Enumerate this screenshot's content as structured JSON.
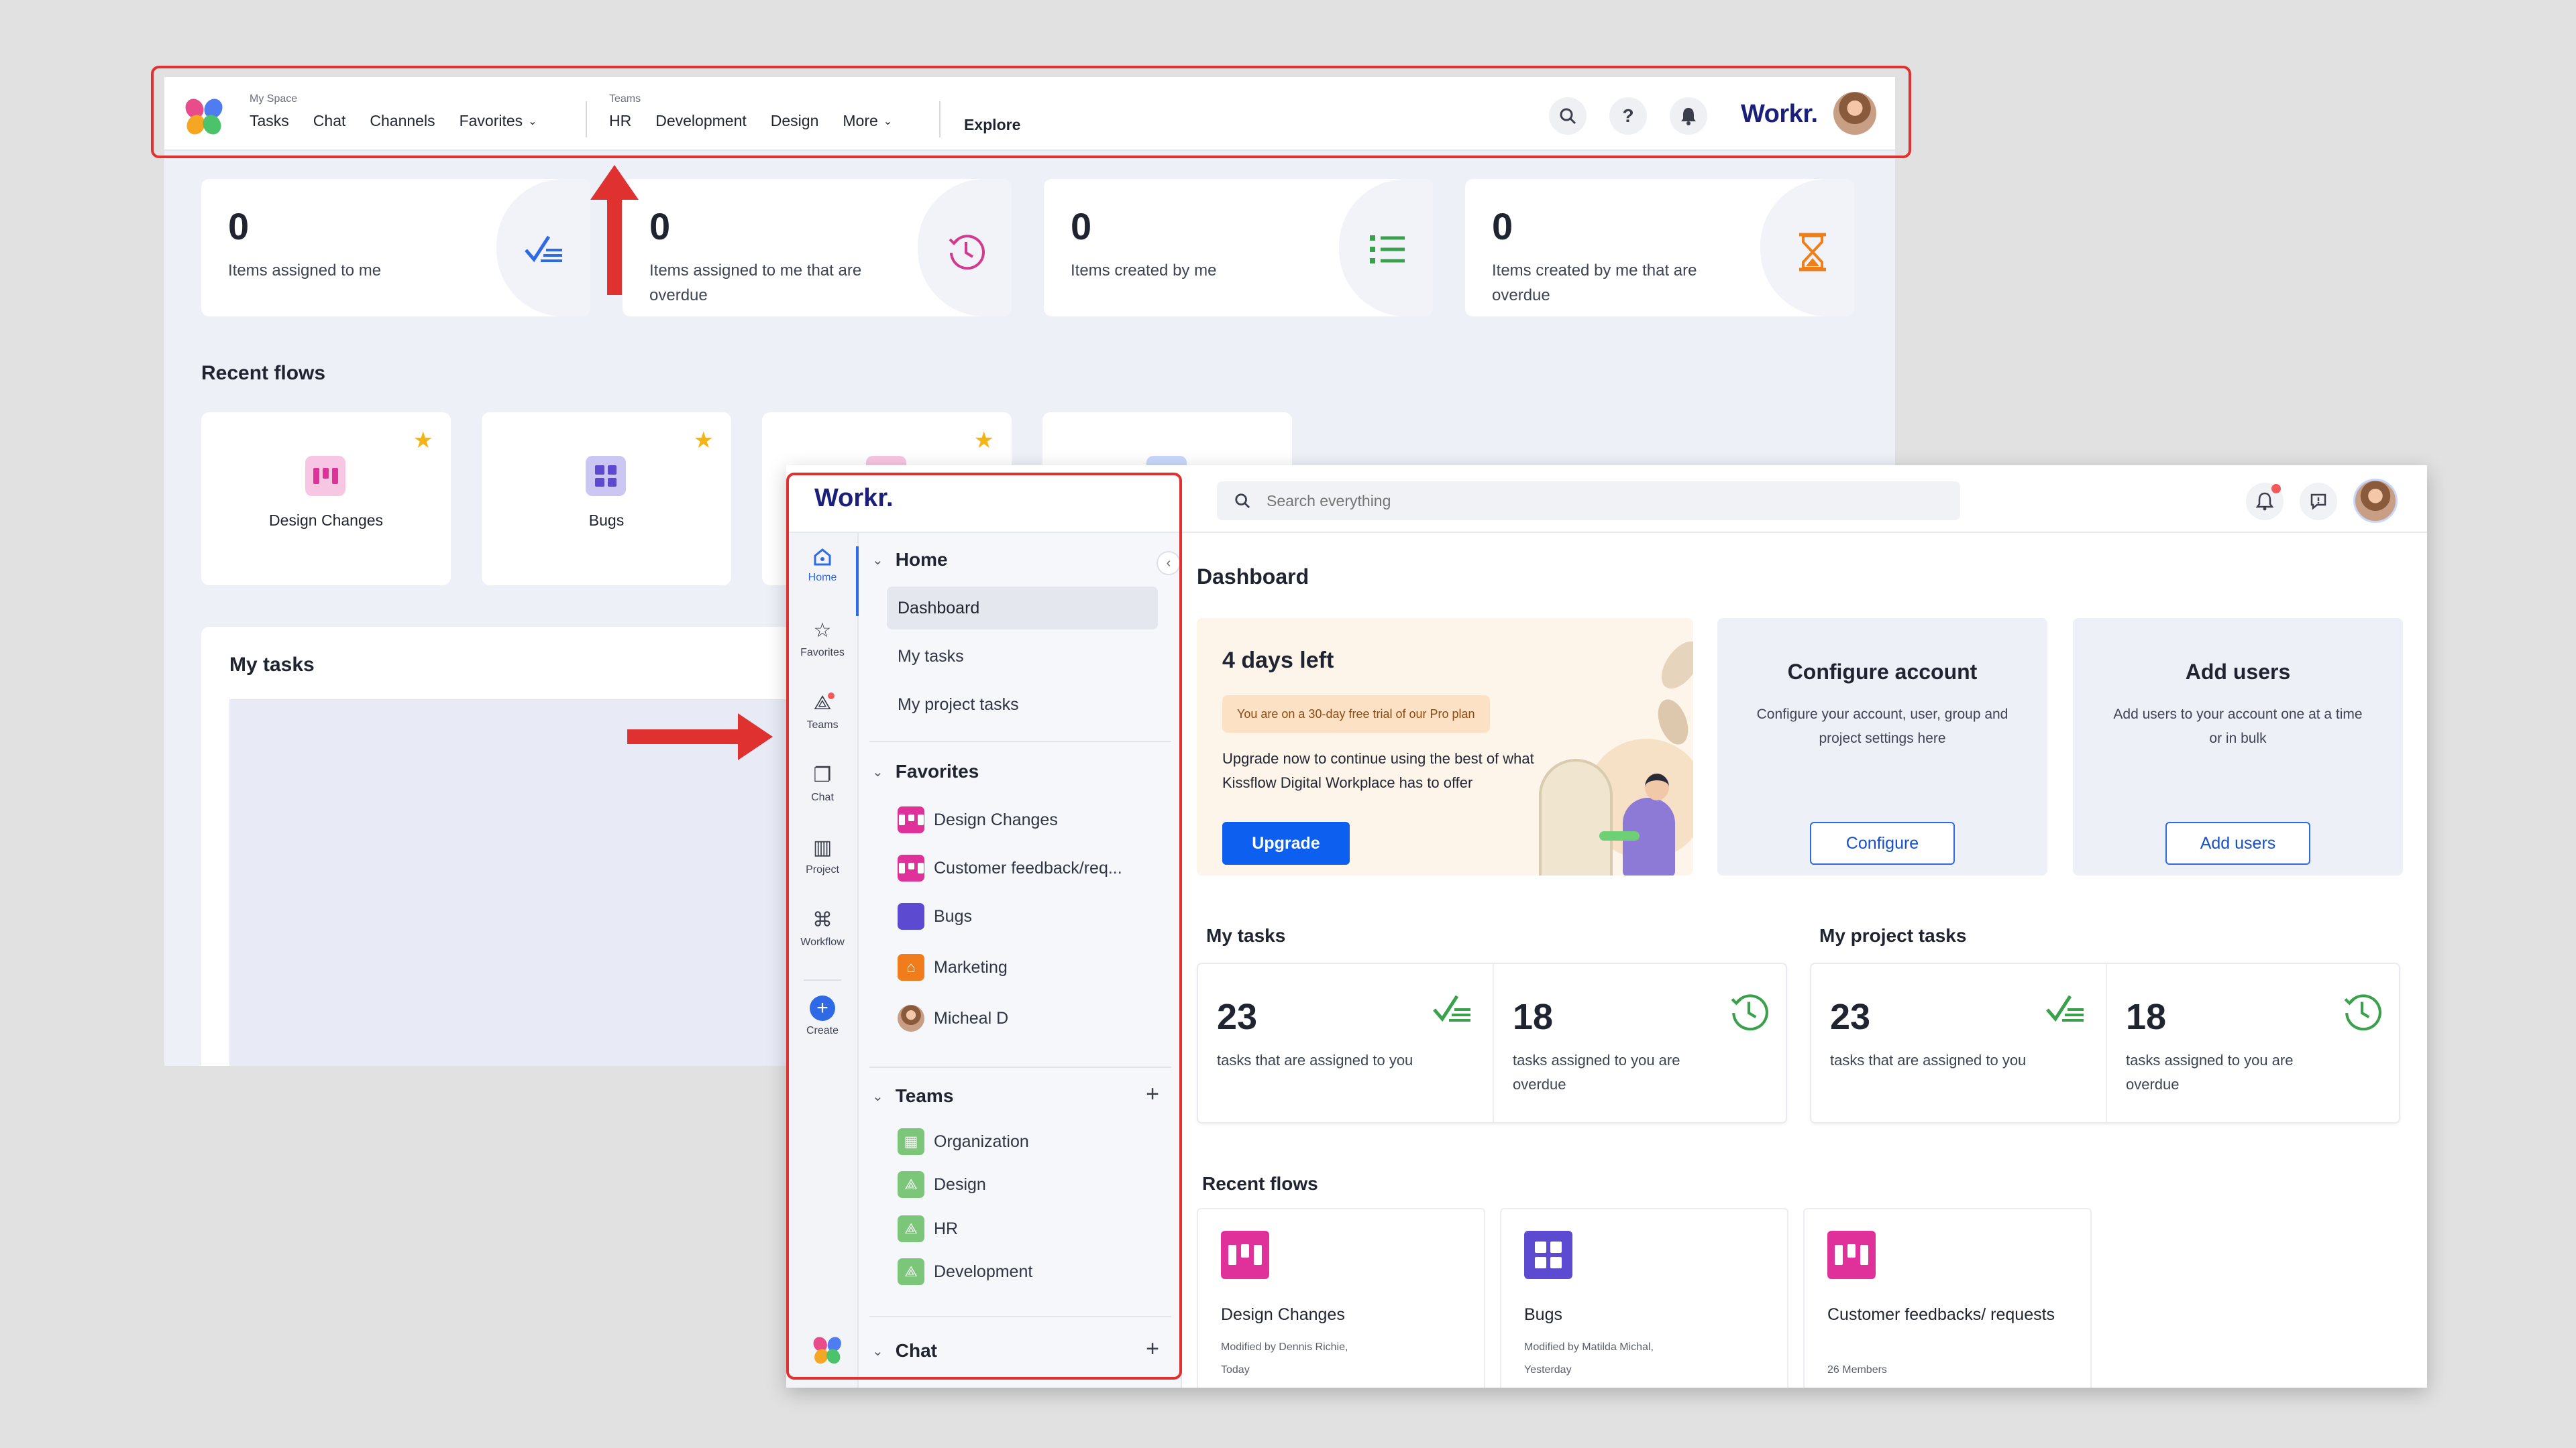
{
  "old_ui": {
    "nav": {
      "my_space_caption": "My Space",
      "my_space_items": [
        "Tasks",
        "Chat",
        "Channels",
        "Favorites"
      ],
      "teams_caption": "Teams",
      "teams_items": [
        "HR",
        "Development",
        "Design",
        "More"
      ],
      "explore": "Explore",
      "brand": "Workr."
    },
    "stats": [
      {
        "value": "0",
        "label": "Items assigned to me",
        "icon": "check-list-icon",
        "color": "#2e6ae6"
      },
      {
        "value": "0",
        "label": "Items assigned to me that are overdue",
        "icon": "clock-history-icon",
        "color": "#d33a8f"
      },
      {
        "value": "0",
        "label": "Items created by me",
        "icon": "bullet-list-icon",
        "color": "#3aa04b"
      },
      {
        "value": "0",
        "label": "Items created by me that are overdue",
        "icon": "hourglass-icon",
        "color": "#ef7f1a"
      }
    ],
    "recent_flows_title": "Recent flows",
    "recent_flows": [
      "Design Changes",
      "Bugs"
    ],
    "my_tasks_title": "My tasks"
  },
  "new_ui": {
    "brand": "Workr.",
    "rail": [
      {
        "label": "Home",
        "icon": "home-icon"
      },
      {
        "label": "Favorites",
        "icon": "star-icon"
      },
      {
        "label": "Teams",
        "icon": "teams-icon"
      },
      {
        "label": "Chat",
        "icon": "chat-icon"
      },
      {
        "label": "Project",
        "icon": "project-icon"
      },
      {
        "label": "Workflow",
        "icon": "workflow-icon"
      },
      {
        "label": "Create",
        "icon": "plus-icon"
      }
    ],
    "sidebar": {
      "home": {
        "title": "Home",
        "items": [
          "Dashboard",
          "My tasks",
          "My project tasks"
        ]
      },
      "favorites": {
        "title": "Favorites",
        "items": [
          "Design Changes",
          "Customer feedback/req...",
          "Bugs",
          "Marketing",
          "Micheal D"
        ]
      },
      "teams": {
        "title": "Teams",
        "items": [
          "Organization",
          "Design",
          "HR",
          "Development"
        ]
      },
      "chat": {
        "title": "Chat"
      }
    },
    "search": {
      "placeholder": "Search everything"
    },
    "page_title": "Dashboard",
    "trial": {
      "title": "4 days left",
      "badge": "You are on a 30-day free trial of our Pro plan",
      "desc": "Upgrade now to continue using the best of what Kissflow Digital Workplace has to offer",
      "button": "Upgrade"
    },
    "configure": {
      "title": "Configure account",
      "desc": "Configure your account, user, group and project settings here",
      "button": "Configure"
    },
    "add_users": {
      "title": "Add users",
      "desc": "Add users to your account one at a time or in bulk",
      "button": "Add users"
    },
    "my_tasks": {
      "title": "My tasks",
      "assigned_value": "23",
      "assigned_label": "tasks that are assigned to you",
      "overdue_value": "18",
      "overdue_label": "tasks assigned to you are overdue"
    },
    "my_project_tasks": {
      "title": "My project tasks",
      "assigned_value": "23",
      "assigned_label": "tasks that are assigned to you",
      "overdue_value": "18",
      "overdue_label": "tasks assigned to you are overdue"
    },
    "recent_flows": {
      "title": "Recent flows",
      "items": [
        {
          "name": "Design Changes",
          "meta1": "Modified by Dennis Richie,",
          "meta2": "Today"
        },
        {
          "name": "Bugs",
          "meta1": "Modified by Matilda Michal,",
          "meta2": "Yesterday"
        },
        {
          "name": "Customer feedbacks/ requests",
          "meta1": "26 Members",
          "meta2": ""
        }
      ]
    }
  },
  "colors": {
    "highlight": "#e03131",
    "accent": "#2e6ae6",
    "brand": "#1a1f7a"
  }
}
